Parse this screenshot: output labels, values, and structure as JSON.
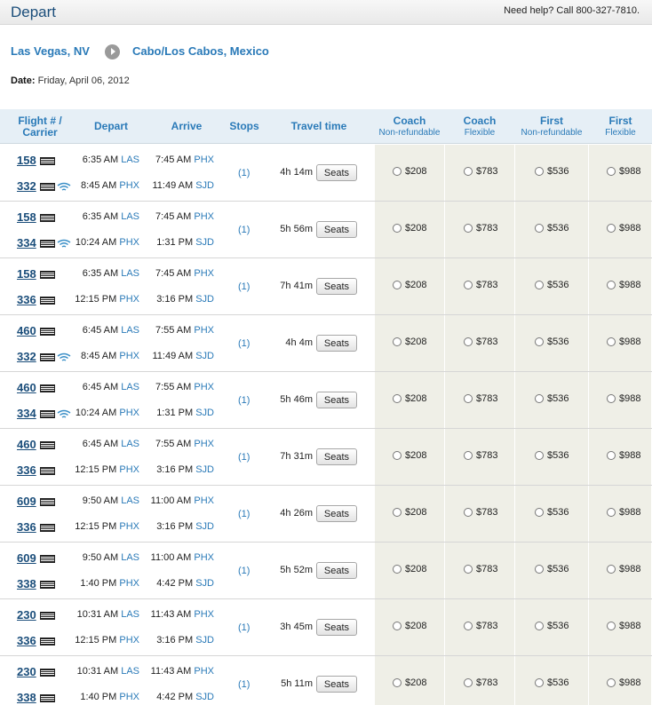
{
  "header": {
    "title": "Depart",
    "help": "Need help? Call 800-327-7810."
  },
  "route": {
    "origin": "Las Vegas, NV",
    "destination": "Cabo/Los Cabos, Mexico"
  },
  "date": {
    "label": "Date:",
    "value": "Friday, April 06, 2012"
  },
  "columns": {
    "flight": "Flight # / Carrier",
    "depart": "Depart",
    "arrive": "Arrive",
    "stops": "Stops",
    "travel": "Travel time",
    "fares": [
      {
        "title": "Coach",
        "sub": "Non-refundable"
      },
      {
        "title": "Coach",
        "sub": "Flexible"
      },
      {
        "title": "First",
        "sub": "Non-refundable"
      },
      {
        "title": "First",
        "sub": "Flexible"
      }
    ]
  },
  "seats_label": "Seats",
  "fare_prices": [
    "$208",
    "$783",
    "$536",
    "$988"
  ],
  "flights": [
    {
      "legs": [
        {
          "num": "158",
          "wifi": false,
          "dep": "6:35 AM",
          "dep_ap": "LAS",
          "arr": "7:45 AM",
          "arr_ap": "PHX"
        },
        {
          "num": "332",
          "wifi": true,
          "dep": "8:45 AM",
          "dep_ap": "PHX",
          "arr": "11:49 AM",
          "arr_ap": "SJD"
        }
      ],
      "stops": "(1)",
      "travel": "4h 14m"
    },
    {
      "legs": [
        {
          "num": "158",
          "wifi": false,
          "dep": "6:35 AM",
          "dep_ap": "LAS",
          "arr": "7:45 AM",
          "arr_ap": "PHX"
        },
        {
          "num": "334",
          "wifi": true,
          "dep": "10:24 AM",
          "dep_ap": "PHX",
          "arr": "1:31 PM",
          "arr_ap": "SJD"
        }
      ],
      "stops": "(1)",
      "travel": "5h 56m"
    },
    {
      "legs": [
        {
          "num": "158",
          "wifi": false,
          "dep": "6:35 AM",
          "dep_ap": "LAS",
          "arr": "7:45 AM",
          "arr_ap": "PHX"
        },
        {
          "num": "336",
          "wifi": false,
          "dep": "12:15 PM",
          "dep_ap": "PHX",
          "arr": "3:16 PM",
          "arr_ap": "SJD"
        }
      ],
      "stops": "(1)",
      "travel": "7h 41m"
    },
    {
      "legs": [
        {
          "num": "460",
          "wifi": false,
          "dep": "6:45 AM",
          "dep_ap": "LAS",
          "arr": "7:55 AM",
          "arr_ap": "PHX"
        },
        {
          "num": "332",
          "wifi": true,
          "dep": "8:45 AM",
          "dep_ap": "PHX",
          "arr": "11:49 AM",
          "arr_ap": "SJD"
        }
      ],
      "stops": "(1)",
      "travel": "4h 4m"
    },
    {
      "legs": [
        {
          "num": "460",
          "wifi": false,
          "dep": "6:45 AM",
          "dep_ap": "LAS",
          "arr": "7:55 AM",
          "arr_ap": "PHX"
        },
        {
          "num": "334",
          "wifi": true,
          "dep": "10:24 AM",
          "dep_ap": "PHX",
          "arr": "1:31 PM",
          "arr_ap": "SJD"
        }
      ],
      "stops": "(1)",
      "travel": "5h 46m"
    },
    {
      "legs": [
        {
          "num": "460",
          "wifi": false,
          "dep": "6:45 AM",
          "dep_ap": "LAS",
          "arr": "7:55 AM",
          "arr_ap": "PHX"
        },
        {
          "num": "336",
          "wifi": false,
          "dep": "12:15 PM",
          "dep_ap": "PHX",
          "arr": "3:16 PM",
          "arr_ap": "SJD"
        }
      ],
      "stops": "(1)",
      "travel": "7h 31m"
    },
    {
      "legs": [
        {
          "num": "609",
          "wifi": false,
          "dep": "9:50 AM",
          "dep_ap": "LAS",
          "arr": "11:00 AM",
          "arr_ap": "PHX"
        },
        {
          "num": "336",
          "wifi": false,
          "dep": "12:15 PM",
          "dep_ap": "PHX",
          "arr": "3:16 PM",
          "arr_ap": "SJD"
        }
      ],
      "stops": "(1)",
      "travel": "4h 26m"
    },
    {
      "legs": [
        {
          "num": "609",
          "wifi": false,
          "dep": "9:50 AM",
          "dep_ap": "LAS",
          "arr": "11:00 AM",
          "arr_ap": "PHX"
        },
        {
          "num": "338",
          "wifi": false,
          "dep": "1:40 PM",
          "dep_ap": "PHX",
          "arr": "4:42 PM",
          "arr_ap": "SJD"
        }
      ],
      "stops": "(1)",
      "travel": "5h 52m"
    },
    {
      "legs": [
        {
          "num": "230",
          "wifi": false,
          "dep": "10:31 AM",
          "dep_ap": "LAS",
          "arr": "11:43 AM",
          "arr_ap": "PHX"
        },
        {
          "num": "336",
          "wifi": false,
          "dep": "12:15 PM",
          "dep_ap": "PHX",
          "arr": "3:16 PM",
          "arr_ap": "SJD"
        }
      ],
      "stops": "(1)",
      "travel": "3h 45m"
    },
    {
      "legs": [
        {
          "num": "230",
          "wifi": false,
          "dep": "10:31 AM",
          "dep_ap": "LAS",
          "arr": "11:43 AM",
          "arr_ap": "PHX"
        },
        {
          "num": "338",
          "wifi": false,
          "dep": "1:40 PM",
          "dep_ap": "PHX",
          "arr": "4:42 PM",
          "arr_ap": "SJD"
        }
      ],
      "stops": "(1)",
      "travel": "5h 11m"
    }
  ],
  "colors": {
    "link_blue": "#2a7ab8",
    "title_blue": "#1a4d7a",
    "header_bg": "#e6eff6",
    "fare_bg": "#efefe7"
  }
}
